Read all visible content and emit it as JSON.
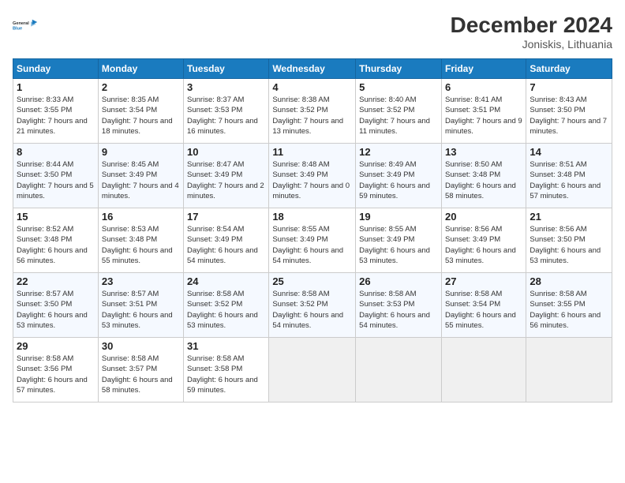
{
  "header": {
    "logo_general": "General",
    "logo_blue": "Blue",
    "month_year": "December 2024",
    "location": "Joniskis, Lithuania"
  },
  "days_of_week": [
    "Sunday",
    "Monday",
    "Tuesday",
    "Wednesday",
    "Thursday",
    "Friday",
    "Saturday"
  ],
  "weeks": [
    [
      {
        "day": "1",
        "sunrise": "8:33 AM",
        "sunset": "3:55 PM",
        "daylight": "7 hours and 21 minutes."
      },
      {
        "day": "2",
        "sunrise": "8:35 AM",
        "sunset": "3:54 PM",
        "daylight": "7 hours and 18 minutes."
      },
      {
        "day": "3",
        "sunrise": "8:37 AM",
        "sunset": "3:53 PM",
        "daylight": "7 hours and 16 minutes."
      },
      {
        "day": "4",
        "sunrise": "8:38 AM",
        "sunset": "3:52 PM",
        "daylight": "7 hours and 13 minutes."
      },
      {
        "day": "5",
        "sunrise": "8:40 AM",
        "sunset": "3:52 PM",
        "daylight": "7 hours and 11 minutes."
      },
      {
        "day": "6",
        "sunrise": "8:41 AM",
        "sunset": "3:51 PM",
        "daylight": "7 hours and 9 minutes."
      },
      {
        "day": "7",
        "sunrise": "8:43 AM",
        "sunset": "3:50 PM",
        "daylight": "7 hours and 7 minutes."
      }
    ],
    [
      {
        "day": "8",
        "sunrise": "8:44 AM",
        "sunset": "3:50 PM",
        "daylight": "7 hours and 5 minutes."
      },
      {
        "day": "9",
        "sunrise": "8:45 AM",
        "sunset": "3:49 PM",
        "daylight": "7 hours and 4 minutes."
      },
      {
        "day": "10",
        "sunrise": "8:47 AM",
        "sunset": "3:49 PM",
        "daylight": "7 hours and 2 minutes."
      },
      {
        "day": "11",
        "sunrise": "8:48 AM",
        "sunset": "3:49 PM",
        "daylight": "7 hours and 0 minutes."
      },
      {
        "day": "12",
        "sunrise": "8:49 AM",
        "sunset": "3:49 PM",
        "daylight": "6 hours and 59 minutes."
      },
      {
        "day": "13",
        "sunrise": "8:50 AM",
        "sunset": "3:48 PM",
        "daylight": "6 hours and 58 minutes."
      },
      {
        "day": "14",
        "sunrise": "8:51 AM",
        "sunset": "3:48 PM",
        "daylight": "6 hours and 57 minutes."
      }
    ],
    [
      {
        "day": "15",
        "sunrise": "8:52 AM",
        "sunset": "3:48 PM",
        "daylight": "6 hours and 56 minutes."
      },
      {
        "day": "16",
        "sunrise": "8:53 AM",
        "sunset": "3:48 PM",
        "daylight": "6 hours and 55 minutes."
      },
      {
        "day": "17",
        "sunrise": "8:54 AM",
        "sunset": "3:49 PM",
        "daylight": "6 hours and 54 minutes."
      },
      {
        "day": "18",
        "sunrise": "8:55 AM",
        "sunset": "3:49 PM",
        "daylight": "6 hours and 54 minutes."
      },
      {
        "day": "19",
        "sunrise": "8:55 AM",
        "sunset": "3:49 PM",
        "daylight": "6 hours and 53 minutes."
      },
      {
        "day": "20",
        "sunrise": "8:56 AM",
        "sunset": "3:49 PM",
        "daylight": "6 hours and 53 minutes."
      },
      {
        "day": "21",
        "sunrise": "8:56 AM",
        "sunset": "3:50 PM",
        "daylight": "6 hours and 53 minutes."
      }
    ],
    [
      {
        "day": "22",
        "sunrise": "8:57 AM",
        "sunset": "3:50 PM",
        "daylight": "6 hours and 53 minutes."
      },
      {
        "day": "23",
        "sunrise": "8:57 AM",
        "sunset": "3:51 PM",
        "daylight": "6 hours and 53 minutes."
      },
      {
        "day": "24",
        "sunrise": "8:58 AM",
        "sunset": "3:52 PM",
        "daylight": "6 hours and 53 minutes."
      },
      {
        "day": "25",
        "sunrise": "8:58 AM",
        "sunset": "3:52 PM",
        "daylight": "6 hours and 54 minutes."
      },
      {
        "day": "26",
        "sunrise": "8:58 AM",
        "sunset": "3:53 PM",
        "daylight": "6 hours and 54 minutes."
      },
      {
        "day": "27",
        "sunrise": "8:58 AM",
        "sunset": "3:54 PM",
        "daylight": "6 hours and 55 minutes."
      },
      {
        "day": "28",
        "sunrise": "8:58 AM",
        "sunset": "3:55 PM",
        "daylight": "6 hours and 56 minutes."
      }
    ],
    [
      {
        "day": "29",
        "sunrise": "8:58 AM",
        "sunset": "3:56 PM",
        "daylight": "6 hours and 57 minutes."
      },
      {
        "day": "30",
        "sunrise": "8:58 AM",
        "sunset": "3:57 PM",
        "daylight": "6 hours and 58 minutes."
      },
      {
        "day": "31",
        "sunrise": "8:58 AM",
        "sunset": "3:58 PM",
        "daylight": "6 hours and 59 minutes."
      },
      null,
      null,
      null,
      null
    ]
  ],
  "labels": {
    "sunrise": "Sunrise:",
    "sunset": "Sunset:",
    "daylight": "Daylight:"
  }
}
